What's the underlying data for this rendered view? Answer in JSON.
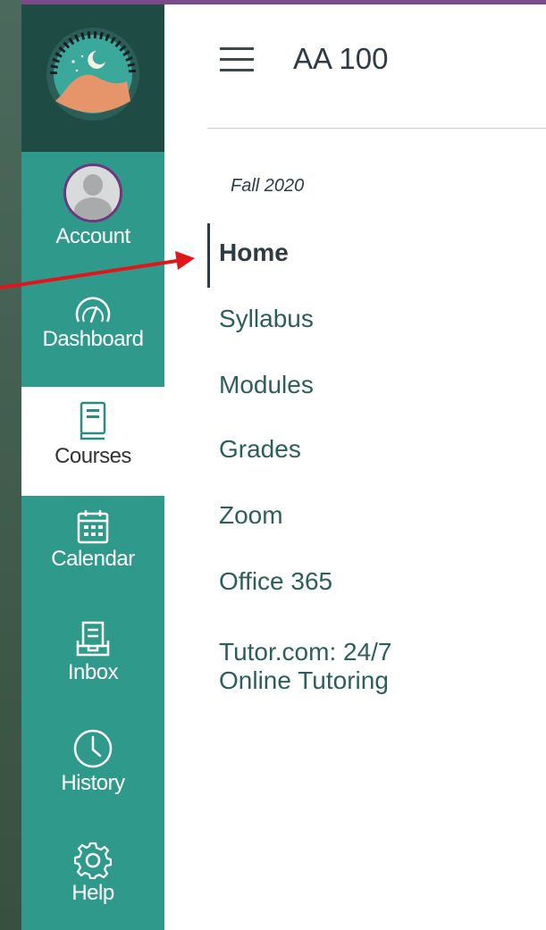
{
  "global_nav": {
    "items": [
      {
        "label": "Account",
        "icon": "avatar"
      },
      {
        "label": "Dashboard",
        "icon": "dashboard-icon"
      },
      {
        "label": "Courses",
        "icon": "courses-icon"
      },
      {
        "label": "Calendar",
        "icon": "calendar-icon"
      },
      {
        "label": "Inbox",
        "icon": "inbox-icon"
      },
      {
        "label": "History",
        "icon": "clock-icon"
      },
      {
        "label": "Help",
        "icon": "gear-icon"
      }
    ],
    "active": "Courses"
  },
  "header": {
    "course_title": "AA 100"
  },
  "course": {
    "term": "Fall 2020",
    "nav": [
      "Home",
      "Syllabus",
      "Modules",
      "Grades",
      "Zoom",
      "Office 365",
      "Tutor.com: 24/7",
      "Online Tutoring"
    ],
    "active": "Home"
  },
  "colors": {
    "nav_bg": "#2f9a8c",
    "logo_bg": "#1e4c45",
    "accent_bar": "#7b4a8c",
    "annotation_arrow": "#e0161b"
  }
}
